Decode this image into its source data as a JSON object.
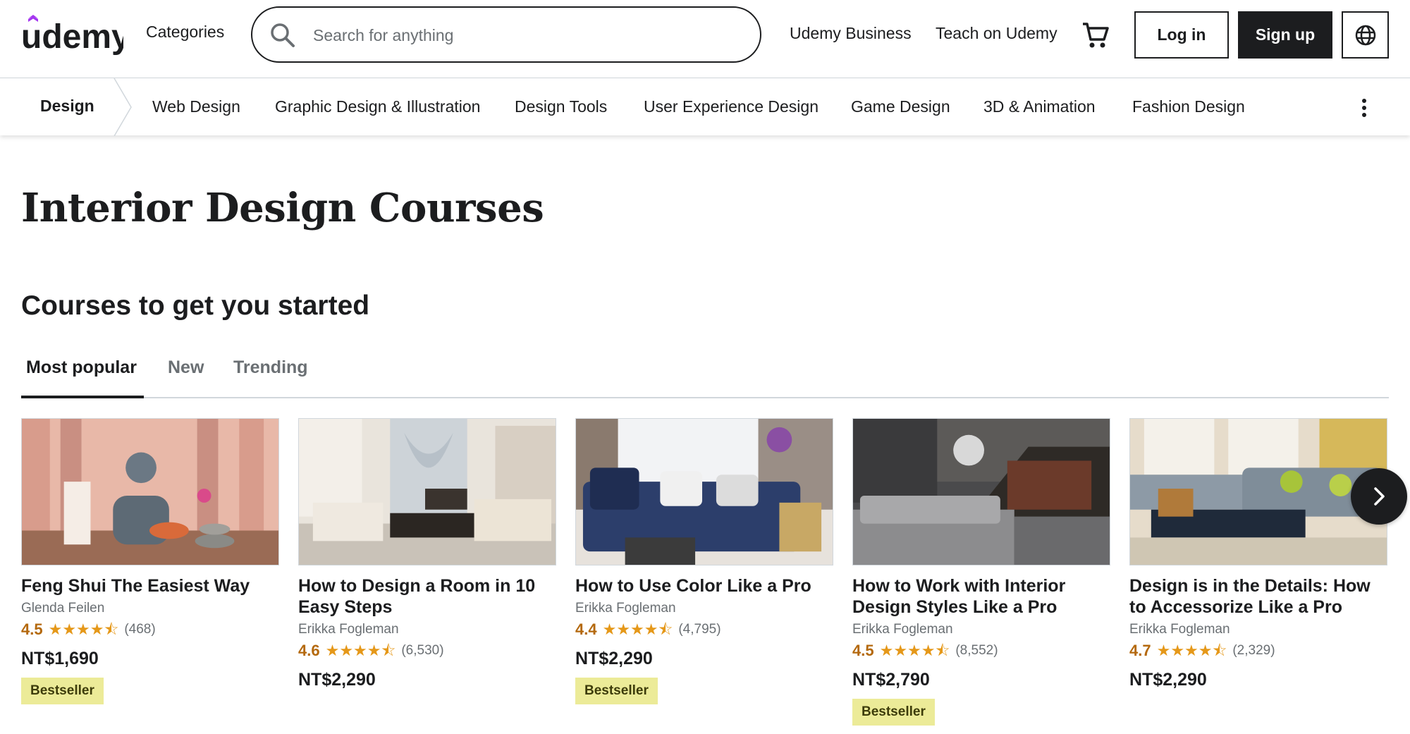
{
  "header": {
    "logo_text": "udemy",
    "categories_label": "Categories",
    "search_placeholder": "Search for anything",
    "business_link": "Udemy Business",
    "teach_link": "Teach on Udemy",
    "login_label": "Log in",
    "signup_label": "Sign up",
    "brand_color": "#a435f0"
  },
  "subnav": {
    "current": "Design",
    "items": [
      "Web Design",
      "Graphic Design & Illustration",
      "Design Tools",
      "User Experience Design",
      "Game Design",
      "3D & Animation",
      "Fashion Design"
    ]
  },
  "page": {
    "title": "Interior Design Courses",
    "section_title": "Courses to get you started"
  },
  "tabs": [
    {
      "label": "Most popular",
      "active": true
    },
    {
      "label": "New",
      "active": false
    },
    {
      "label": "Trending",
      "active": false
    }
  ],
  "courses": [
    {
      "title": "Feng Shui The Easiest Way",
      "author": "Glenda Feilen",
      "rating": "4.5",
      "reviews": "(468)",
      "price": "NT$1,690",
      "badge": "Bestseller"
    },
    {
      "title": "How to Design a Room in 10 Easy Steps",
      "author": "Erikka Fogleman",
      "rating": "4.6",
      "reviews": "(6,530)",
      "price": "NT$2,290",
      "badge": ""
    },
    {
      "title": "How to Use Color Like a Pro",
      "author": "Erikka Fogleman",
      "rating": "4.4",
      "reviews": "(4,795)",
      "price": "NT$2,290",
      "badge": "Bestseller"
    },
    {
      "title": "How to Work with Interior Design Styles Like a Pro",
      "author": "Erikka Fogleman",
      "rating": "4.5",
      "reviews": "(8,552)",
      "price": "NT$2,790",
      "badge": "Bestseller"
    },
    {
      "title": "Design is in the Details: How to Accessorize Like a Pro",
      "author": "Erikka Fogleman",
      "rating": "4.7",
      "reviews": "(2,329)",
      "price": "NT$2,290",
      "badge": ""
    }
  ],
  "colors": {
    "text": "#1c1d1f",
    "muted": "#6a6f73",
    "rating": "#b4690e",
    "star": "#e59819",
    "badge_bg": "#eceb98",
    "badge_text": "#3d3c0a"
  }
}
